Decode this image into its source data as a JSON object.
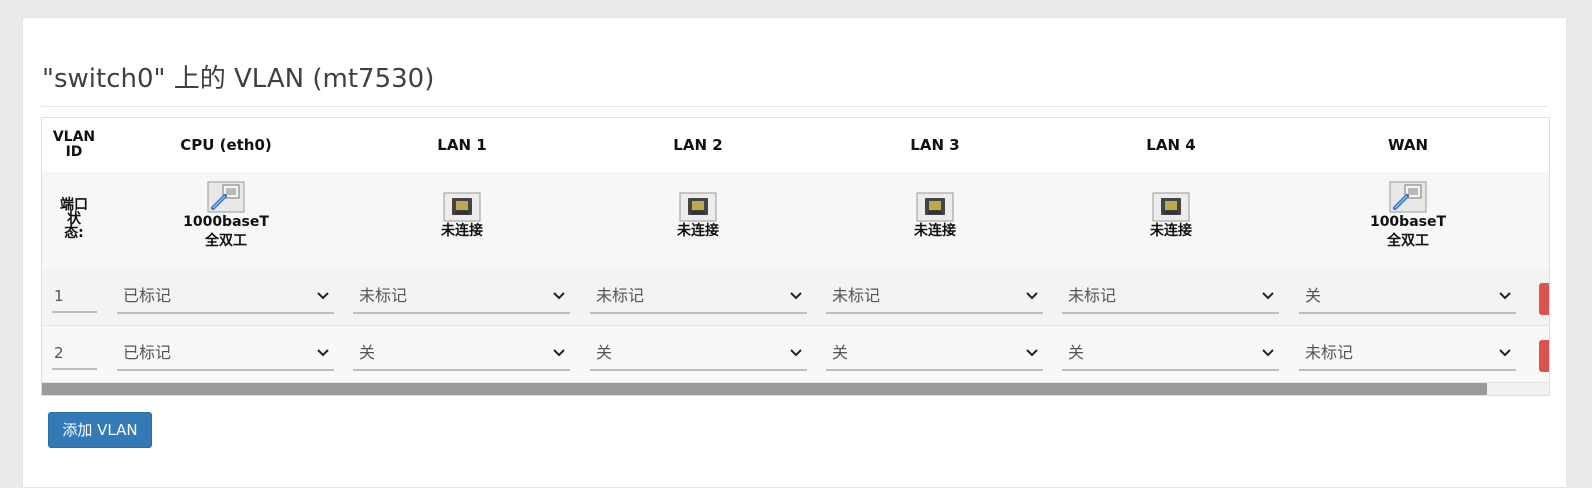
{
  "page": {
    "title": "\"switch0\" 上的 VLAN (mt7530)",
    "add_button": "添加 VLAN"
  },
  "table": {
    "headers": [
      "VLAN ID",
      "CPU (eth0)",
      "LAN 1",
      "LAN 2",
      "LAN 3",
      "LAN 4",
      "WAN"
    ],
    "vlan_id_header_lines": [
      "VLAN",
      "ID"
    ],
    "status_label_lines": [
      "端口",
      "状",
      "态:"
    ],
    "ports": [
      {
        "icon": "ethernet-connected-icon",
        "line1": "1000baseT",
        "line2": "全双工",
        "connected": true
      },
      {
        "icon": "ethernet-disconnected-icon",
        "line1": "未连接",
        "line2": "",
        "connected": false
      },
      {
        "icon": "ethernet-disconnected-icon",
        "line1": "未连接",
        "line2": "",
        "connected": false
      },
      {
        "icon": "ethernet-disconnected-icon",
        "line1": "未连接",
        "line2": "",
        "connected": false
      },
      {
        "icon": "ethernet-disconnected-icon",
        "line1": "未连接",
        "line2": "",
        "connected": false
      },
      {
        "icon": "ethernet-connected-icon",
        "line1": "100baseT",
        "line2": "全双工",
        "connected": true
      }
    ],
    "rows": [
      {
        "vlan_id": "1",
        "values": [
          "已标记",
          "未标记",
          "未标记",
          "未标记",
          "未标记",
          "关"
        ]
      },
      {
        "vlan_id": "2",
        "values": [
          "已标记",
          "关",
          "关",
          "关",
          "关",
          "未标记"
        ]
      }
    ]
  },
  "colors": {
    "primary_button": "#337ab7",
    "delete_button": "#d9534f"
  }
}
